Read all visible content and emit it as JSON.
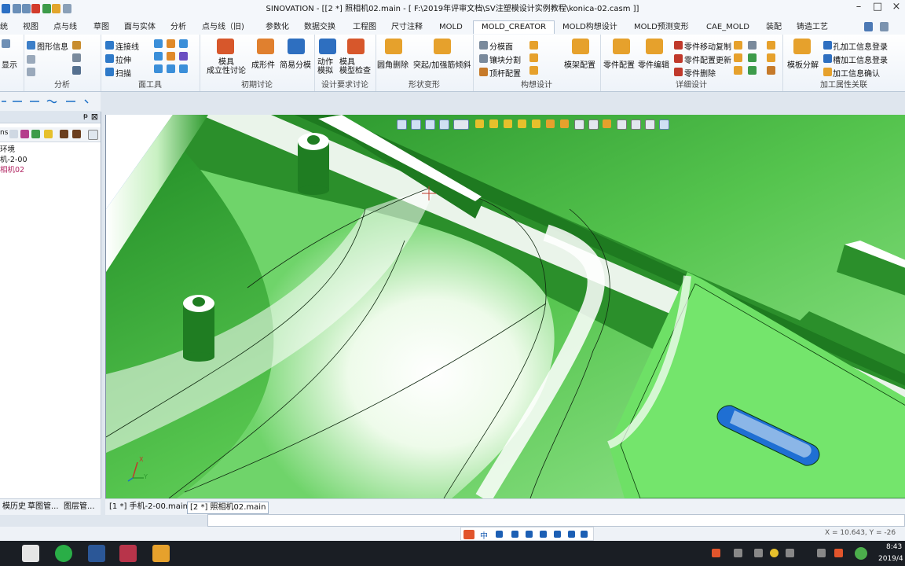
{
  "window": {
    "title": "SINOVATION - [[2 *] 照相机02.main - [ F:\\2019年评审文档\\SV注塑模设计实例教程\\konica-02.casm ]]"
  },
  "tabs": [
    "统",
    "视图",
    "点与线",
    "草图",
    "面与实体",
    "分析",
    "点与线（旧)",
    "参数化",
    "数据交换",
    "工程图",
    "尺寸注释",
    "MOLD",
    "MOLD_CREATOR",
    "MOLD构想设计",
    "MOLD预测变形",
    "CAE_MOLD",
    "装配",
    "铸造工艺"
  ],
  "ribbon": {
    "group_analysis": {
      "cmd_show": "显示",
      "cmd_info": "图形信息",
      "label": "分析"
    },
    "group_surface": {
      "cmd_connect": "连接线",
      "cmd_extrude": "拉伸",
      "cmd_sweep": "扫描",
      "label": "面工具"
    },
    "group_initial": {
      "cmd_mold_setup": "模具\n成立性讨论",
      "cmd_form": "成形件",
      "cmd_simple_split": "简易分模",
      "label": "初期讨论"
    },
    "group_design_req": {
      "cmd_motion": "动作\n模拟",
      "cmd_check": "模具\n模型检查",
      "label": "设计要求讨论"
    },
    "group_shape": {
      "cmd_fillet_del": "圆角删除",
      "cmd_boss": "突起/加强筋倾斜",
      "label": "形状变形"
    },
    "group_construct": {
      "cmd_split_face": "分模面",
      "cmd_block_split": "镶块分割",
      "cmd_ejector": "顶杆配置",
      "cmd_frame": "模架配置",
      "label": "构想设计"
    },
    "group_detail": {
      "cmd_part_config": "零件配置",
      "cmd_part_edit": "零件编辑",
      "cmd_move_copy": "零件移动复制",
      "cmd_update": "零件配置更新",
      "cmd_delete": "零件删除",
      "label": "详细设计"
    },
    "group_machining": {
      "cmd_mold_split": "模板分解",
      "cmd_hole_reg": "孔加工信息登录",
      "cmd_groove_reg": "槽加工信息登录",
      "cmd_confirm": "加工信息确认",
      "label": "加工属性关联"
    }
  },
  "left_panel": {
    "toolbar_label": "ns",
    "tree": [
      "环境",
      "机-2-00",
      "相机02"
    ]
  },
  "viewport": {
    "axis_x": "X",
    "axis_y": "Y"
  },
  "left_tabs": [
    "模历史",
    "草图管...",
    "图层管..."
  ],
  "doc_tabs": [
    "[1 *] 手机-2-00.main",
    "[2 *] 照相机02.main"
  ],
  "status": {
    "coords": "X = 10.643, Y = -26"
  },
  "ime": {
    "label": "中"
  },
  "taskbar": {
    "time": "8:43",
    "date": "2019/4"
  },
  "colors": {
    "model_green": "#2e9a2e",
    "background_blue": "#1f6fd3",
    "highlight_white": "#ffffff"
  }
}
